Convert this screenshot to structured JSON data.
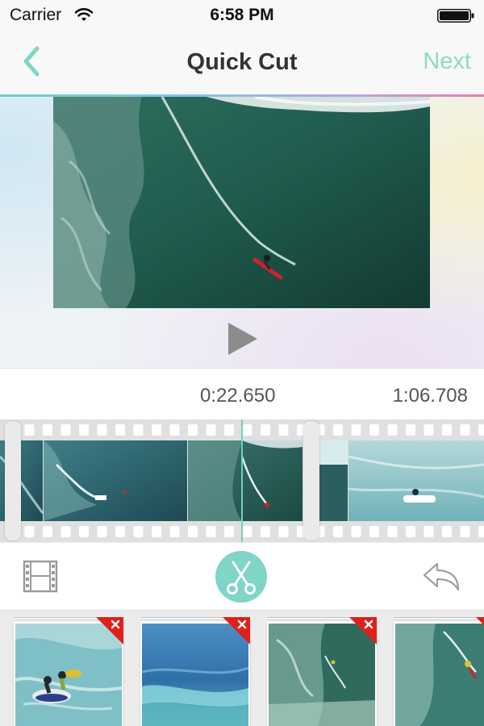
{
  "status_bar": {
    "carrier": "Carrier",
    "time": "6:58 PM",
    "icons": [
      "wifi-icon",
      "battery-icon"
    ]
  },
  "nav": {
    "title": "Quick Cut",
    "next_label": "Next",
    "back_icon": "chevron-left-icon",
    "accent_color": "#6fd0c3",
    "next_color": "#8ed8c8"
  },
  "player": {
    "play_icon": "play-icon",
    "current_time": "0:22.650",
    "total_time": "1:06.708"
  },
  "toolbar": {
    "icons": [
      "film-icon",
      "scissors-icon",
      "undo-icon"
    ],
    "cut_color": "#7fd5c7"
  },
  "clips": [
    {
      "subject": "jet ski surfers",
      "removable": true
    },
    {
      "subject": "wave barrel",
      "removable": true
    },
    {
      "subject": "aerial surfer",
      "removable": true
    },
    {
      "subject": "surfer on wave",
      "removable": true
    }
  ],
  "remove_badge_color": "#e0211b"
}
